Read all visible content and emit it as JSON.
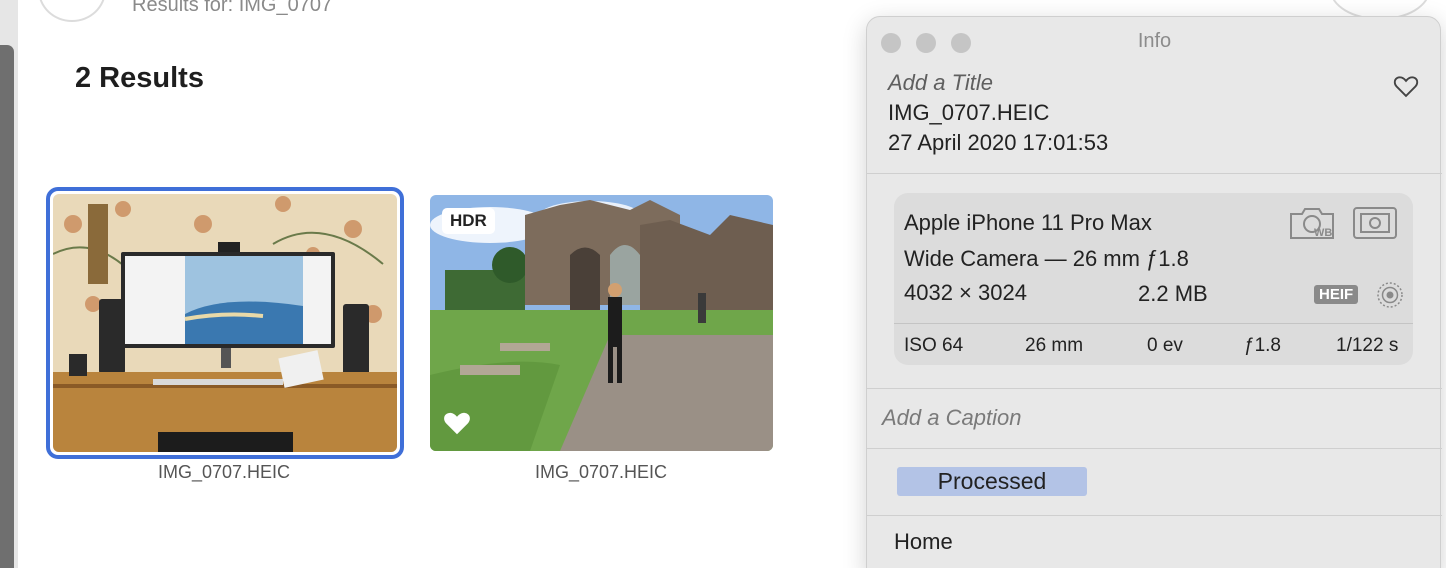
{
  "header": {
    "search_title": "Results for: IMG_0707",
    "results_count": "2 Results"
  },
  "results": [
    {
      "filename": "IMG_0707.HEIC",
      "selected": true,
      "badge": "",
      "favorite": false
    },
    {
      "filename": "IMG_0707.HEIC",
      "selected": false,
      "badge": "HDR",
      "favorite": true
    }
  ],
  "info_panel": {
    "window_title": "Info",
    "title_placeholder": "Add a Title",
    "filename": "IMG_0707.HEIC",
    "date_time": "27 April 2020   17:01:53",
    "camera": {
      "model": "Apple iPhone 11 Pro Max",
      "lens": "Wide Camera — 26 mm ƒ1.8",
      "resolution": "4032 × 3024",
      "file_size": "2.2 MB",
      "format_badge": "HEIF",
      "exif": {
        "iso": "ISO 64",
        "focal_length": "26 mm",
        "exposure_bias": "0 ev",
        "aperture": "ƒ1.8",
        "shutter_speed": "1/122 s"
      }
    },
    "caption_placeholder": "Add a Caption",
    "keyword": "Processed",
    "album": "Home"
  },
  "colors": {
    "selection_border": "#3f6fd8",
    "keyword_bg": "#b3c3e6",
    "panel_bg": "#e8e8e8"
  },
  "icons": [
    "back-icon",
    "heart-icon",
    "favorite-heart-icon",
    "white-balance-icon",
    "metering-icon",
    "live-photo-icon"
  ]
}
